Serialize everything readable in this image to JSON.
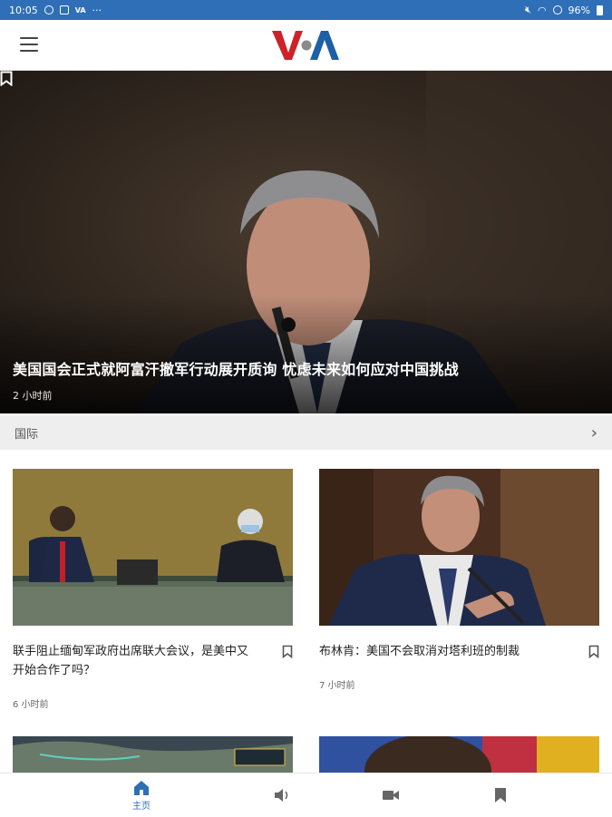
{
  "status_bar": {
    "time": "10:05",
    "battery": "96%"
  },
  "hero": {
    "headline": "美国国会正式就阿富汗撤军行动展开质询 忧虑未来如何应对中国挑战",
    "time": "2 小时前"
  },
  "section": {
    "label": "国际"
  },
  "articles": [
    {
      "headline": "联手阻止缅甸军政府出席联大会议，是美中又开始合作了吗？",
      "time": "6 小时前"
    },
    {
      "headline": "布林肯：美国不会取消对塔利班的制裁",
      "time": "7 小时前"
    }
  ],
  "bottom_nav": {
    "home_label": "主页"
  },
  "colors": {
    "brand_blue": "#2f6fb7",
    "logo_red": "#cc2229",
    "logo_blue": "#1d5fa8"
  }
}
